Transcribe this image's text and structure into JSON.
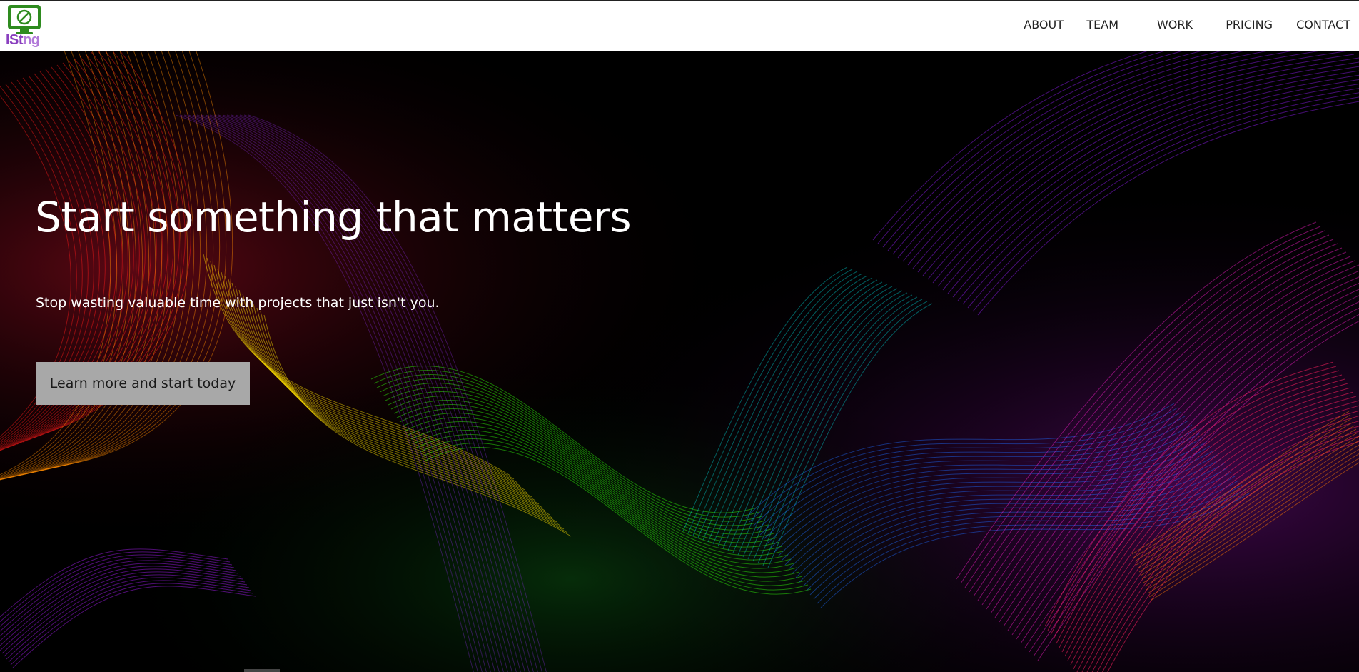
{
  "header": {
    "logo_text": "ISt",
    "logo_text_tail": "ng",
    "nav": [
      {
        "label": "ABOUT"
      },
      {
        "label": "TEAM"
      },
      {
        "label": "WORK"
      },
      {
        "label": "PRICING"
      },
      {
        "label": "CONTACT"
      }
    ]
  },
  "hero": {
    "title": "Start something that matters",
    "subtitle": "Stop wasting valuable time with projects that just isn't you.",
    "cta_label": "Learn more and start today"
  },
  "colors": {
    "nav_text": "#222222",
    "hero_text": "#ffffff",
    "cta_bg": "#a8a8a8",
    "logo_monitor": "#2e8b1f",
    "logo_text": "#8a3fbf"
  },
  "icons": {
    "logo": "monitor-icon"
  }
}
